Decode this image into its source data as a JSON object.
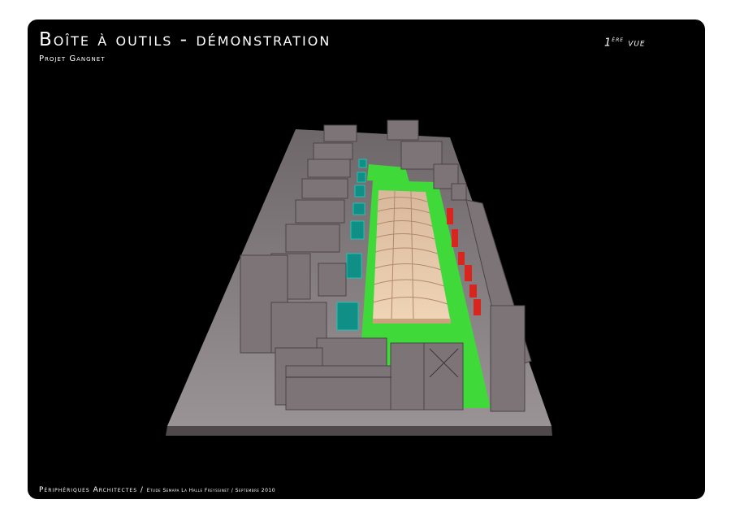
{
  "header": {
    "title": "Boîte à outils - démonstration",
    "subtitle": "Projet Gangnet",
    "view_number": "1",
    "view_suffix": "ère",
    "view_word": "vue"
  },
  "footer": {
    "firm": "Périphériques Architectes /",
    "details": "Etude Semapa La Halle Freyssinet / Septembre 2010"
  },
  "colors": {
    "background": "#000000",
    "model_base": "#8a8285",
    "building": "#7d7477",
    "lawn": "#3fd93a",
    "hall_roof": "#e8c8a8",
    "water": "#0f8f86",
    "trees": "#d8261f"
  },
  "model_image": {
    "description_icon": "architectural-scale-model"
  }
}
